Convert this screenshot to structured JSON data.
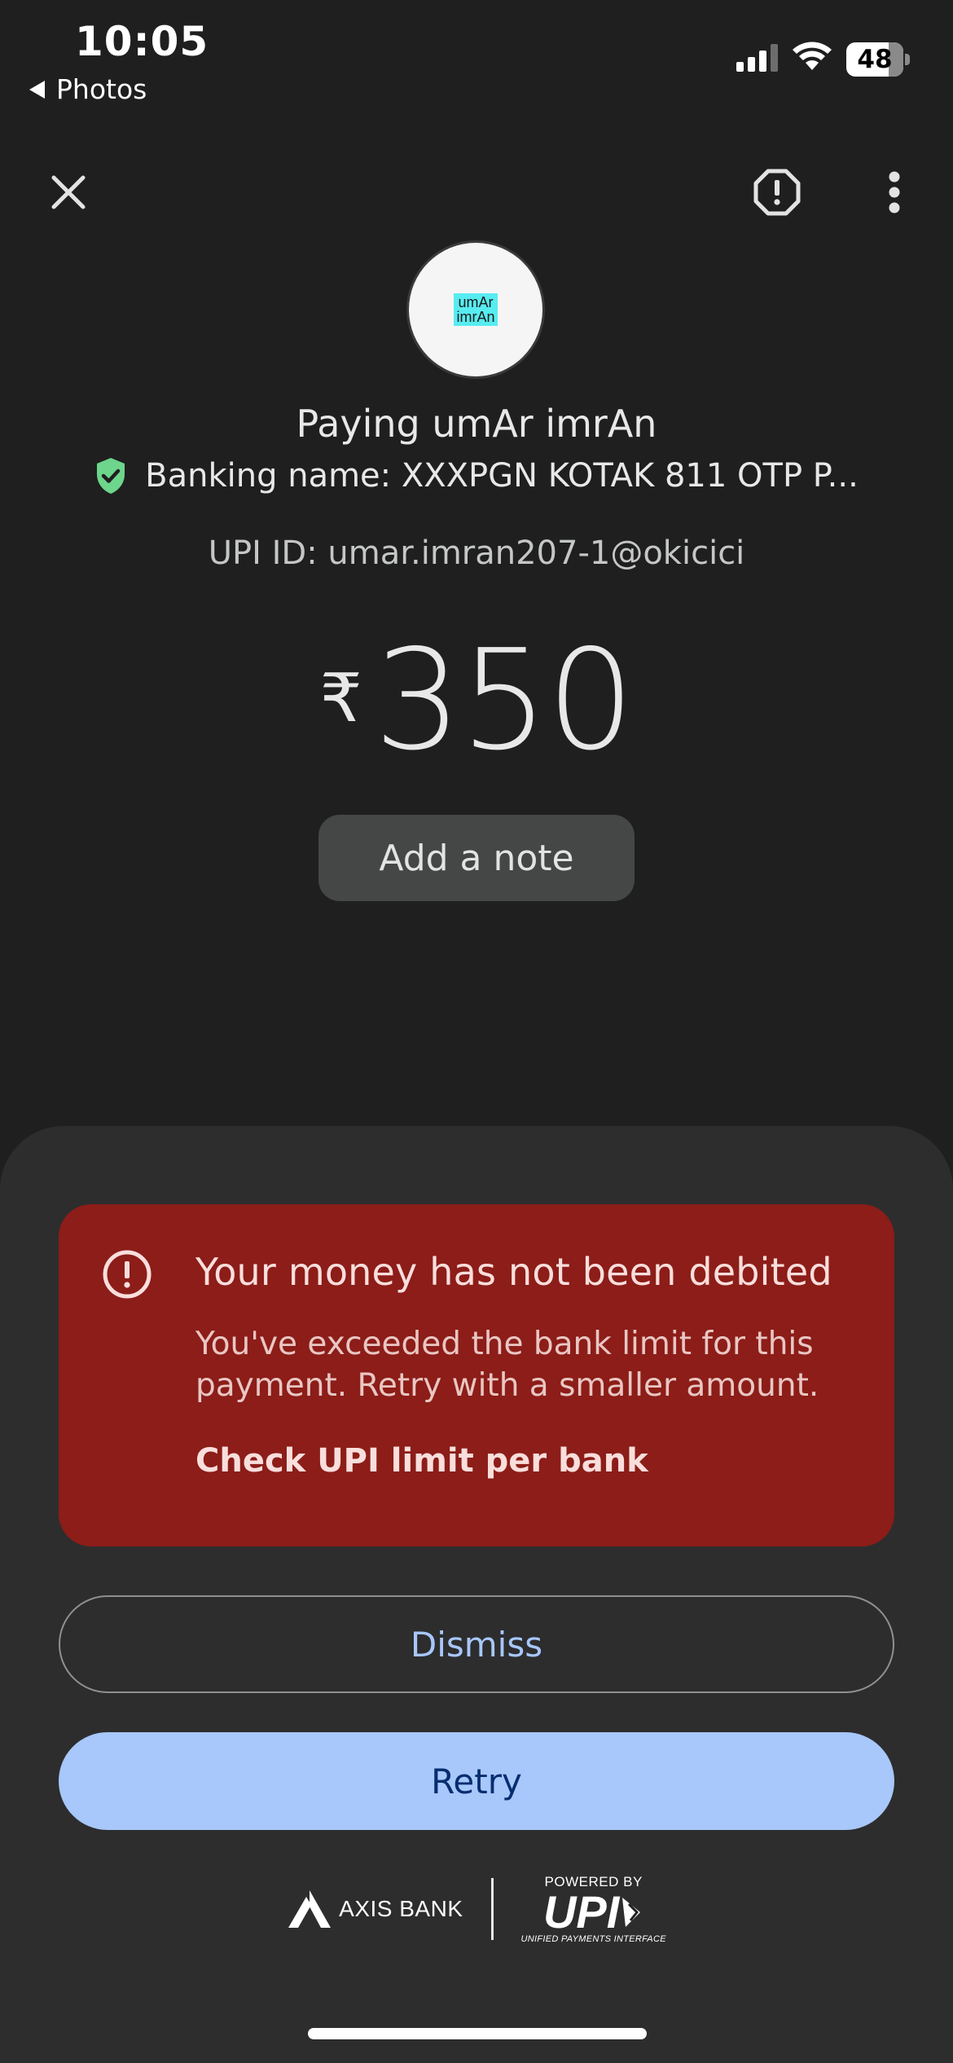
{
  "status_bar": {
    "time": "10:05",
    "back_app": "Photos",
    "battery_level": "48",
    "icons": [
      "signal-icon",
      "wifi-icon",
      "battery-icon"
    ]
  },
  "top_bar": {
    "icons": [
      "close-icon",
      "report-icon",
      "more-vert-icon"
    ]
  },
  "payee": {
    "avatar_text_line1": "umAr",
    "avatar_text_line2": "imrAn",
    "paying_text": "Paying umAr imrAn",
    "banking_name": "Banking name: XXXPGN KOTAK 811 OTP P...",
    "upi_id": "UPI ID: umar.imran207-1@okicici",
    "verified_icon": "verified-shield-icon"
  },
  "amount": {
    "currency": "₹",
    "value": "350"
  },
  "note_button": "Add a note",
  "error": {
    "icon": "error-icon",
    "title": "Your money has not been debited",
    "message": "You've exceeded the bank limit for this payment. Retry with a smaller amount.",
    "link": "Check UPI limit per bank"
  },
  "actions": {
    "dismiss": "Dismiss",
    "retry": "Retry"
  },
  "footer": {
    "bank": "AXIS BANK",
    "powered_by": "POWERED BY",
    "upi": "UPI",
    "upi_sub": "UNIFIED PAYMENTS INTERFACE"
  },
  "colors": {
    "background": "#1f1f1f",
    "sheet": "#2d2d2e",
    "error_bg": "#8c1d18",
    "primary": "#a8c7fa",
    "verified": "#6dd58c"
  }
}
